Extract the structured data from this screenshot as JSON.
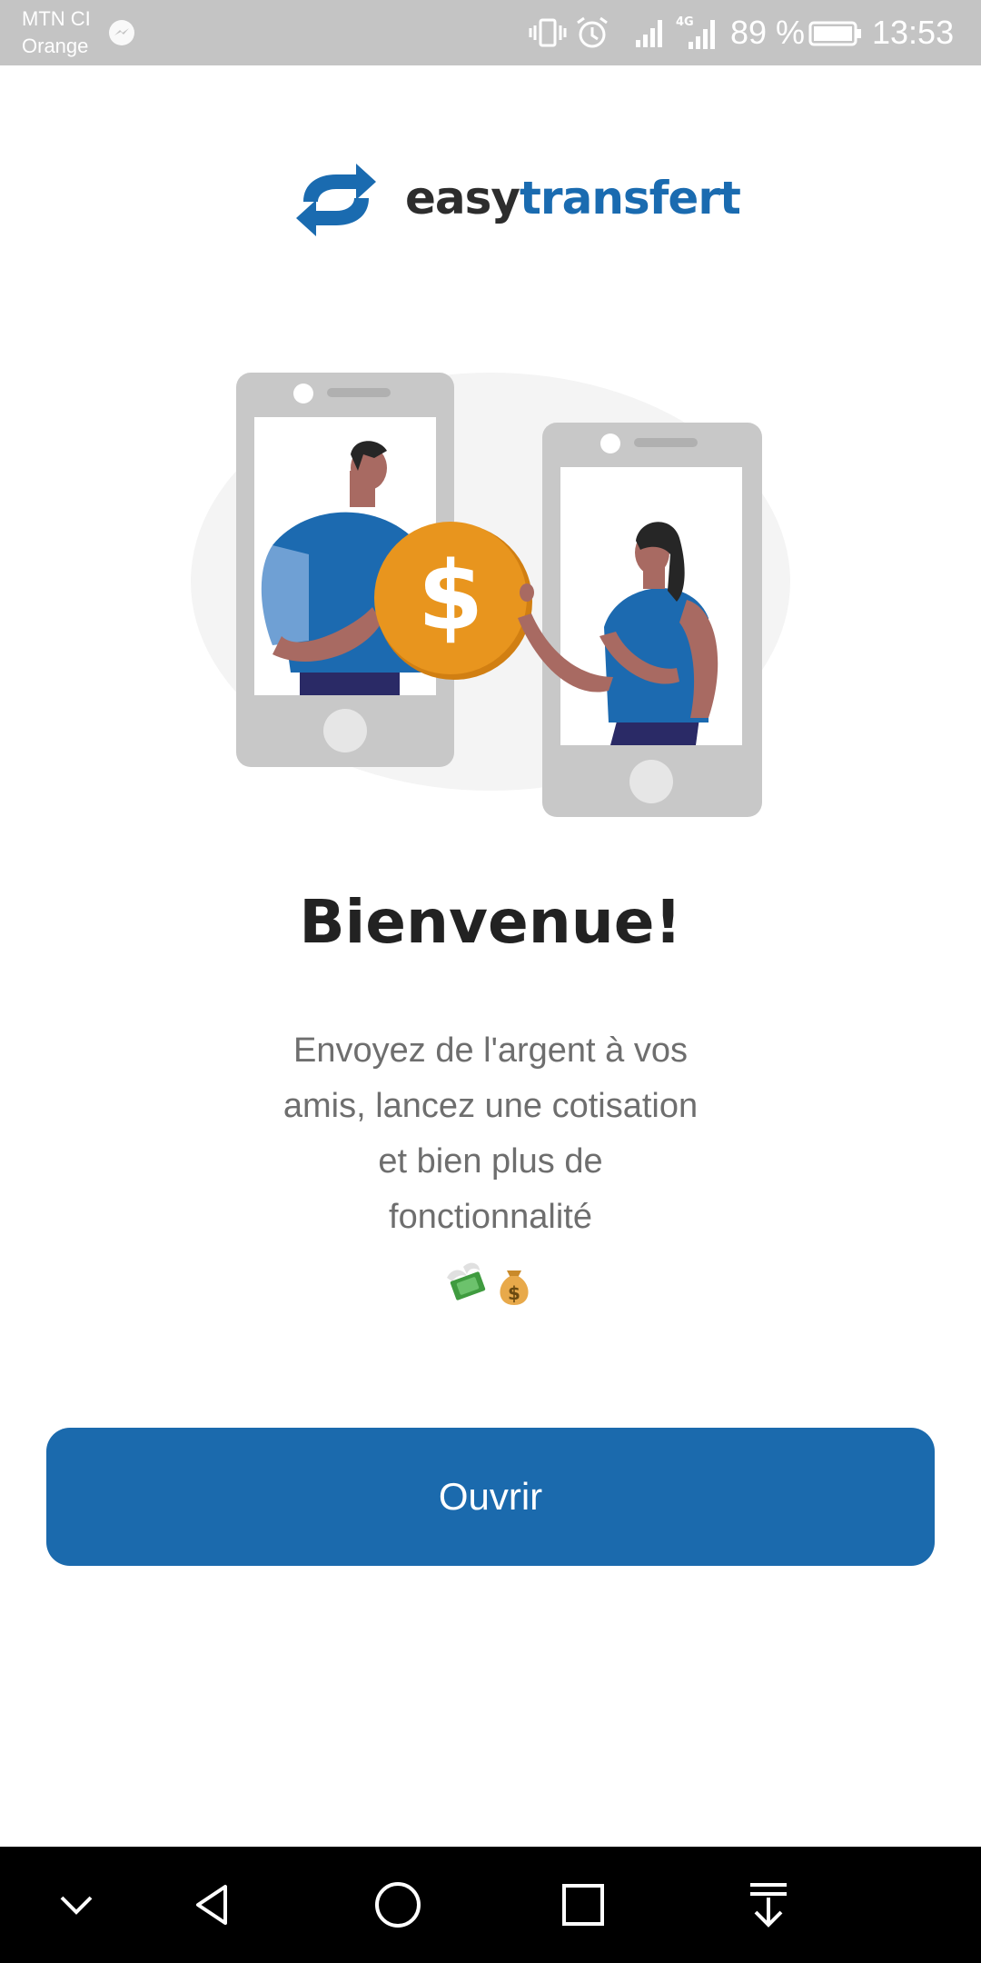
{
  "status_bar": {
    "carrier_line1": "MTN CI",
    "carrier_line2": "Orange",
    "battery_percent": "89 %",
    "time": "13:53",
    "icons": [
      "messenger-icon",
      "vibrate-icon",
      "alarm-icon",
      "signal-icon",
      "signal-4g-icon",
      "battery-icon"
    ]
  },
  "logo": {
    "part1": "easy",
    "part2": "transfert"
  },
  "welcome": {
    "title": "Bienvenue!",
    "description": "Envoyez de l'argent à vos amis, lancez une cotisation et bien plus de fonctionnalité"
  },
  "emojis": [
    "money-with-wings-emoji",
    "money-bag-emoji"
  ],
  "cta": {
    "label": "Ouvrir"
  },
  "nav_bar": {
    "icons": [
      "chevron-down-icon",
      "back-icon",
      "home-icon",
      "recents-icon",
      "notification-pull-icon"
    ]
  },
  "colors": {
    "brand_blue": "#1b6aad",
    "coin_orange": "#e8951e",
    "status_bar": "#c4c4c4"
  }
}
